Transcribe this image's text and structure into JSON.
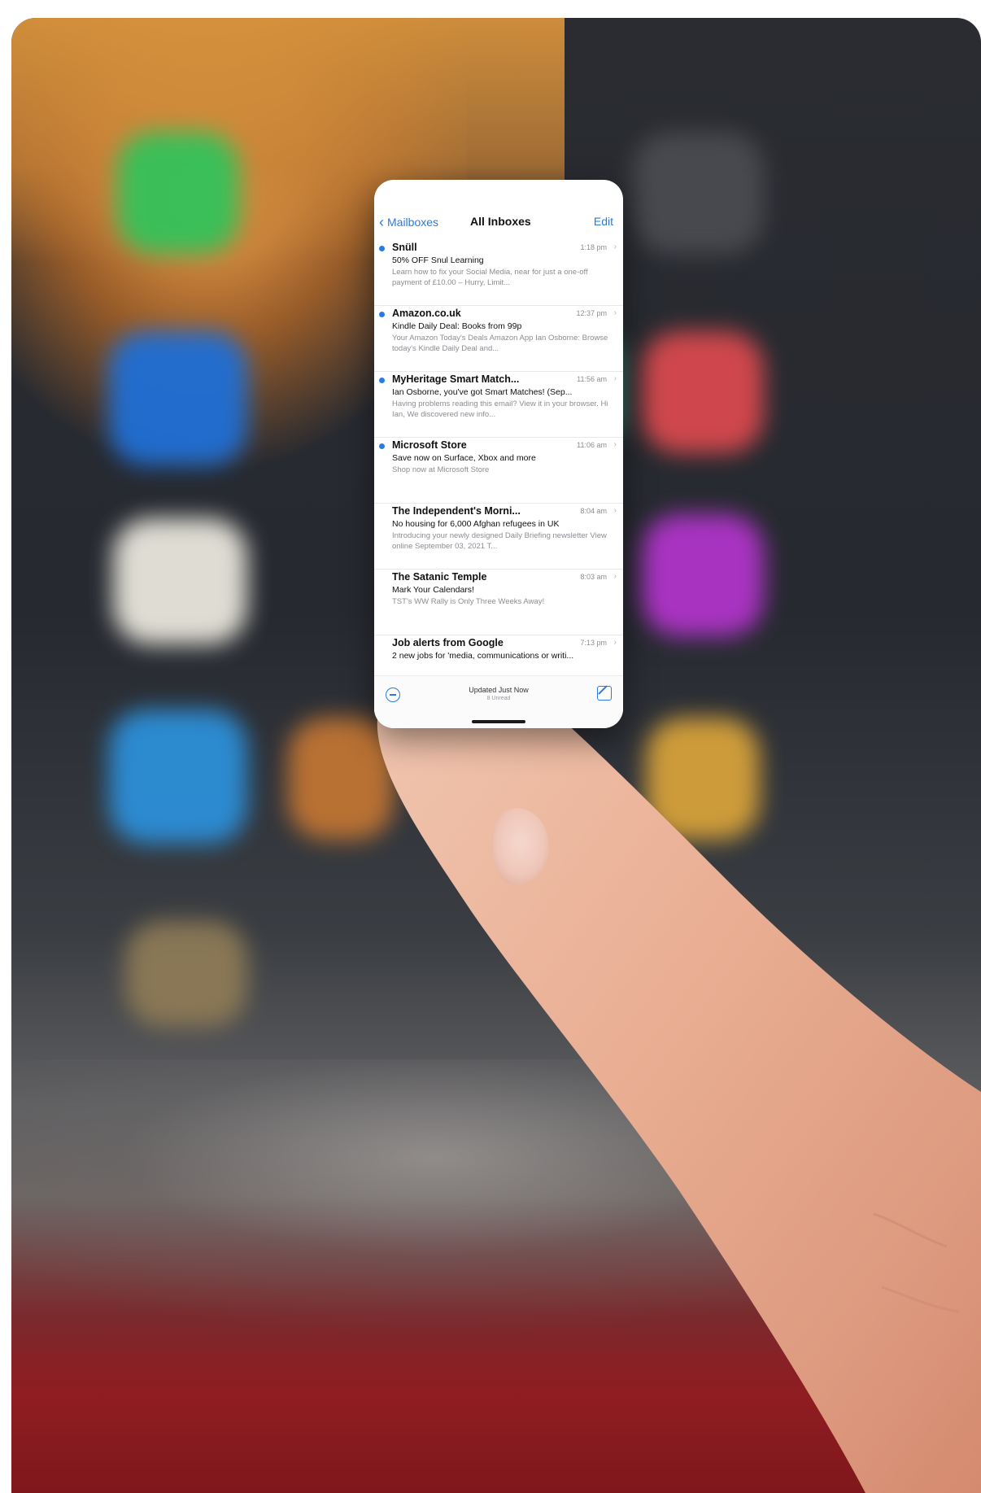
{
  "mail": {
    "back_label": "Mailboxes",
    "title": "All Inboxes",
    "edit_label": "Edit",
    "messages": [
      {
        "sender": "Snüll",
        "time": "1:18 pm",
        "subject": "50% OFF Snul Learning",
        "preview": "Learn how to fix your Social Media, near for just a one-off payment of £10.00 – Hurry, Limit...",
        "unread": true
      },
      {
        "sender": "Amazon.co.uk",
        "time": "12:37 pm",
        "subject": "Kindle Daily Deal: Books from 99p",
        "preview": "Your Amazon Today's Deals Amazon App Ian Osborne: Browse today's Kindle Daily Deal and...",
        "unread": true
      },
      {
        "sender": "MyHeritage Smart Match...",
        "time": "11:56 am",
        "subject": "Ian Osborne, you've got Smart Matches! (Sep...",
        "preview": "Having problems reading this email? View it in your browser. Hi Ian, We discovered new info...",
        "unread": true
      },
      {
        "sender": "Microsoft Store",
        "time": "11:06 am",
        "subject": "Save now on Surface, Xbox and more",
        "preview": "Shop now at Microsoft Store",
        "unread": true
      },
      {
        "sender": "The Independent's Morni...",
        "time": "8:04 am",
        "subject": "No housing for 6,000 Afghan refugees in UK",
        "preview": "Introducing your newly designed Daily Briefing newsletter View online September 03, 2021 T...",
        "unread": false
      },
      {
        "sender": "The Satanic Temple",
        "time": "8:03 am",
        "subject": "Mark Your Calendars!",
        "preview": "TST's WW Rally is Only Three Weeks Away!",
        "unread": false
      },
      {
        "sender": "Job alerts from Google",
        "time": "7:13 pm",
        "subject": "2 new jobs for 'media, communications or writi...",
        "preview": "",
        "unread": false
      }
    ],
    "status": "Updated Just Now",
    "status_sub": "8 Unread"
  },
  "colors": {
    "accent": "#2a7ae2",
    "warm_orange": "#d79a43",
    "bottom_red": "#8c1c20"
  },
  "icons": [
    "chevron-left-icon",
    "filter-icon",
    "compose-icon",
    "chevron-right-icon"
  ]
}
